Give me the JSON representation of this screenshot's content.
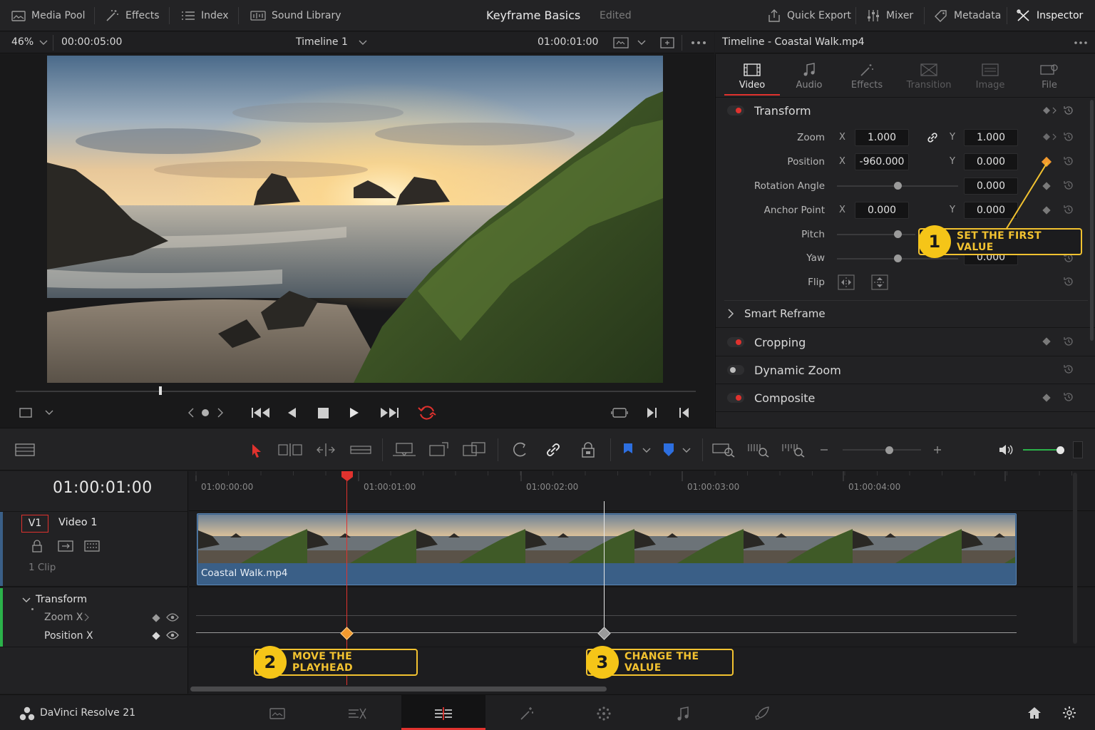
{
  "topbar": {
    "media_pool": "Media Pool",
    "effects": "Effects",
    "index": "Index",
    "sound_library": "Sound Library",
    "project_title": "Keyframe Basics",
    "project_status": "Edited",
    "quick_export": "Quick Export",
    "mixer": "Mixer",
    "metadata": "Metadata",
    "inspector": "Inspector"
  },
  "viewer": {
    "zoom": "46%",
    "duration": "00:00:05:00",
    "timeline_name": "Timeline 1",
    "timecode": "01:00:01:00"
  },
  "inspector": {
    "title": "Timeline - Coastal Walk.mp4",
    "tabs": [
      "Video",
      "Audio",
      "Effects",
      "Transition",
      "Image",
      "File"
    ],
    "active_tab": "Video",
    "transform": {
      "title": "Transform",
      "zoom_label": "Zoom",
      "zoom_x": "1.000",
      "zoom_y": "1.000",
      "position_label": "Position",
      "position_x": "-960.000",
      "position_y": "0.000",
      "rotation_label": "Rotation Angle",
      "rotation": "0.000",
      "anchor_label": "Anchor Point",
      "anchor_x": "0.000",
      "anchor_y": "0.000",
      "pitch_label": "Pitch",
      "yaw_label": "Yaw",
      "yaw": "0.000",
      "flip_label": "Flip",
      "x": "X",
      "y": "Y"
    },
    "smart_reframe": "Smart Reframe",
    "cropping": "Cropping",
    "dynamic_zoom": "Dynamic Zoom",
    "composite": "Composite"
  },
  "timeline": {
    "timecode": "01:00:01:00",
    "ruler": [
      "01:00:00:00",
      "01:00:01:00",
      "01:00:02:00",
      "01:00:03:00",
      "01:00:04:00"
    ],
    "track_id": "V1",
    "track_name": "Video 1",
    "clip_count": "1 Clip",
    "clip_name": "Coastal Walk.mp4",
    "transform_label": "Transform",
    "zoom_x_label": "Zoom X",
    "position_x_label": "Position X"
  },
  "callouts": {
    "c1_num": "1",
    "c1_text": "SET THE FIRST VALUE",
    "c2_num": "2",
    "c2_text": "MOVE THE PLAYHEAD",
    "c3_num": "3",
    "c3_text": "CHANGE THE VALUE"
  },
  "app": {
    "name": "DaVinci Resolve 21"
  },
  "colors": {
    "accent_red": "#e0322e",
    "callout_yellow": "#f5c518",
    "keyframe_orange": "#f29a2e",
    "clip_blue": "#3a5f87"
  }
}
